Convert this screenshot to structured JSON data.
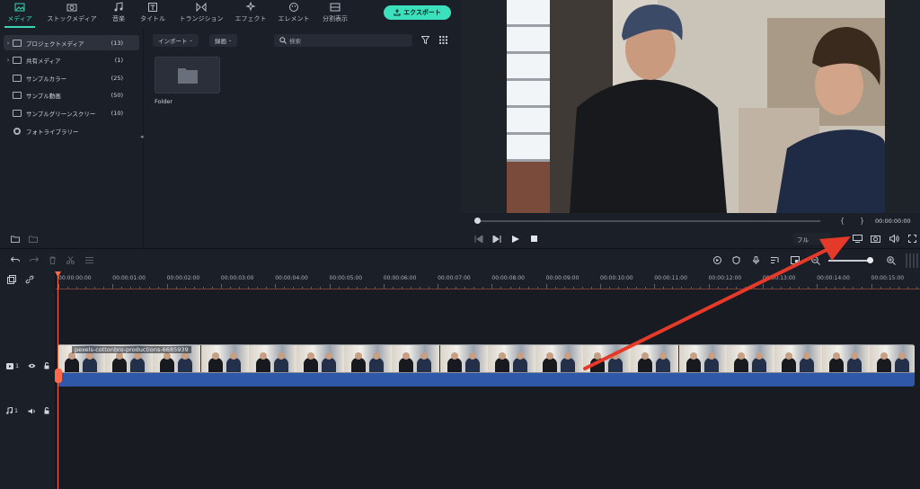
{
  "tabs": [
    {
      "label": "メディア",
      "icon": "media-icon"
    },
    {
      "label": "ストックメディア",
      "icon": "stock-media-icon"
    },
    {
      "label": "音楽",
      "icon": "music-icon"
    },
    {
      "label": "タイトル",
      "icon": "title-icon"
    },
    {
      "label": "トランジション",
      "icon": "transition-icon"
    },
    {
      "label": "エフェクト",
      "icon": "effect-icon"
    },
    {
      "label": "エレメント",
      "icon": "element-icon"
    },
    {
      "label": "分割表示",
      "icon": "split-icon"
    }
  ],
  "export_label": "エクスポート",
  "sidebar": {
    "items": [
      {
        "label": "プロジェクトメディア",
        "count": "(13)",
        "expand": "›"
      },
      {
        "label": "共有メディア",
        "count": "(1)",
        "expand": "›"
      },
      {
        "label": "サンプルカラー",
        "count": "(25)",
        "expand": ""
      },
      {
        "label": "サンプル動画",
        "count": "(50)",
        "expand": ""
      },
      {
        "label": "サンプルグリーンスクリー",
        "count": "(10)",
        "expand": ""
      },
      {
        "label": "フォトライブラリー",
        "count": "",
        "expand": ""
      }
    ]
  },
  "media": {
    "import_label": "インポート",
    "record_label": "録画",
    "search_placeholder": "検索",
    "folder_label": "Folder"
  },
  "player": {
    "timecode": "00:00:00:00",
    "quality": "フル",
    "bracket_left": "{",
    "bracket_right": "}"
  },
  "timeline": {
    "ticks": [
      "00:00:00:00",
      "00:00:01:00",
      "00:00:02:00",
      "00:00:03:00",
      "00:00:04:00",
      "00:00:05:00",
      "00:00:06:00",
      "00:00:07:00",
      "00:00:08:00",
      "00:00:09:00",
      "00:00:10:00",
      "00:00:11:00",
      "00:00:12:00",
      "00:00:13:00",
      "00:00:14:00",
      "00:00:15:00"
    ],
    "video_track_label": "1",
    "audio_track_label": "1",
    "clip_title": "pexels-cottonbro-productions-6685939"
  },
  "annotation_color": "#e53a2a",
  "accent_color": "#37d6b4"
}
